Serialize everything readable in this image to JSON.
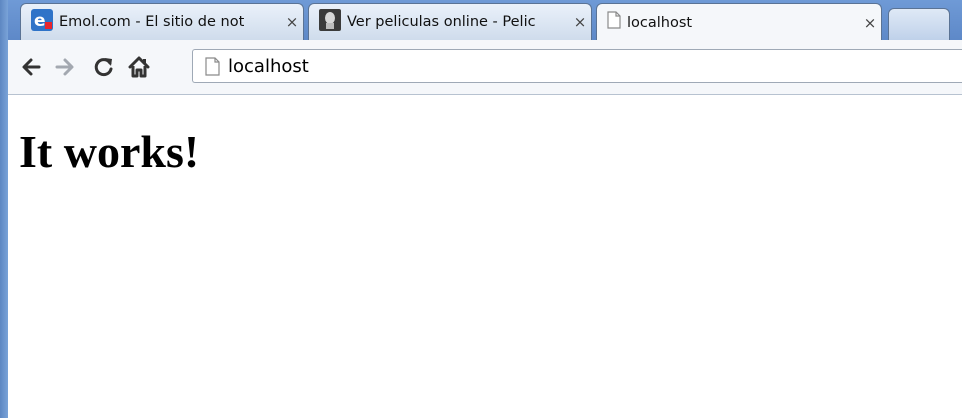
{
  "tabs": [
    {
      "title": "Emol.com - El sitio de not",
      "close": "×",
      "icon": "emol-logo-icon"
    },
    {
      "title": "Ver peliculas online - Pelic",
      "close": "×",
      "icon": "movie-site-icon"
    },
    {
      "title": "localhost",
      "close": "×",
      "icon": "page-icon",
      "active": true
    }
  ],
  "toolbar": {
    "back_icon": "back-arrow-icon",
    "forward_icon": "forward-arrow-icon",
    "reload_icon": "reload-icon",
    "home_icon": "home-icon"
  },
  "omnibox": {
    "value": "localhost"
  },
  "page": {
    "heading": "It works!"
  },
  "colors": {
    "frame": "#6f9ad6",
    "active_tab": "#f5f7fa",
    "emol_brand": "#2f73c8",
    "emol_accent": "#e8252e"
  }
}
